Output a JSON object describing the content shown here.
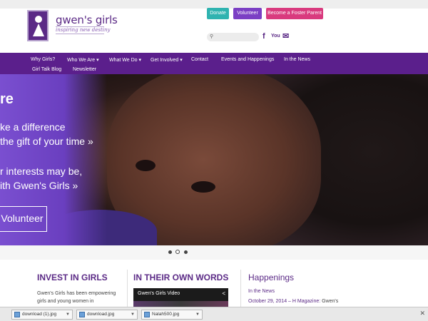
{
  "header": {
    "brand_name": "gwen's girls",
    "tagline": "inspiring new destiny",
    "buttons": {
      "donate": "Donate",
      "volunteer": "Volunteer",
      "foster": "Become a Foster Parent"
    },
    "search_placeholder": "",
    "social": {
      "facebook": "f",
      "youtube": "You",
      "email": "✉"
    }
  },
  "nav": {
    "items": [
      "Why Girls?",
      "Who We Are ▾",
      "What We Do ▾",
      "Get Involved ▾",
      "Contact",
      "Events and Happenings",
      "In the News",
      "Girl Talk Blog",
      "Newsletter"
    ]
  },
  "hero": {
    "title": "re",
    "line1": "ke a difference",
    "line2": "the gift of your time »",
    "line3": "r interests may be,",
    "line4": "ith Gwen's Girls »",
    "button": "Volunteer"
  },
  "carousel": {
    "slides": 3,
    "active": 1
  },
  "columns": {
    "invest": {
      "title": "INVEST IN GIRLS",
      "body1": "Gwen's Girls has been empowering",
      "body2": "girls and young women in"
    },
    "words": {
      "title": "IN THEIR OWN WORDS",
      "video_title": "Gwen's Girls Video",
      "share": "<"
    },
    "happenings": {
      "title": "Happenings",
      "subtitle": "In the News",
      "date": "October 29, 2014 – H Magazine:",
      "date_rest": " Gwen's"
    }
  },
  "downloads": {
    "items": [
      "download (1).jpg",
      "download.jpg",
      "Nalah500.jpg"
    ],
    "close": "✕"
  },
  "colors": {
    "brand_purple": "#5b2a86",
    "nav_purple": "#5b1f8c",
    "donate": "#2fb3b0",
    "volunteer": "#7b3fc4",
    "foster": "#d93a7e"
  }
}
